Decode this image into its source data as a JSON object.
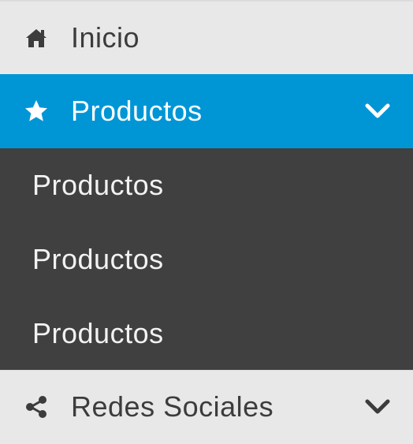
{
  "menu": {
    "home": {
      "label": "Inicio",
      "icon": "home-icon"
    },
    "products": {
      "label": "Productos",
      "icon": "star-icon",
      "expanded": true,
      "chevron": "chevron-down-icon",
      "items": [
        {
          "label": "Productos"
        },
        {
          "label": "Productos"
        },
        {
          "label": "Productos"
        }
      ]
    },
    "social": {
      "label": "Redes Sociales",
      "icon": "share-icon",
      "chevron": "chevron-down-icon"
    }
  },
  "colors": {
    "active_bg": "#0096d6",
    "submenu_bg": "#404040",
    "item_bg": "#e8e8e8",
    "text_dark": "#3c3c3c",
    "text_light": "#ffffff"
  }
}
